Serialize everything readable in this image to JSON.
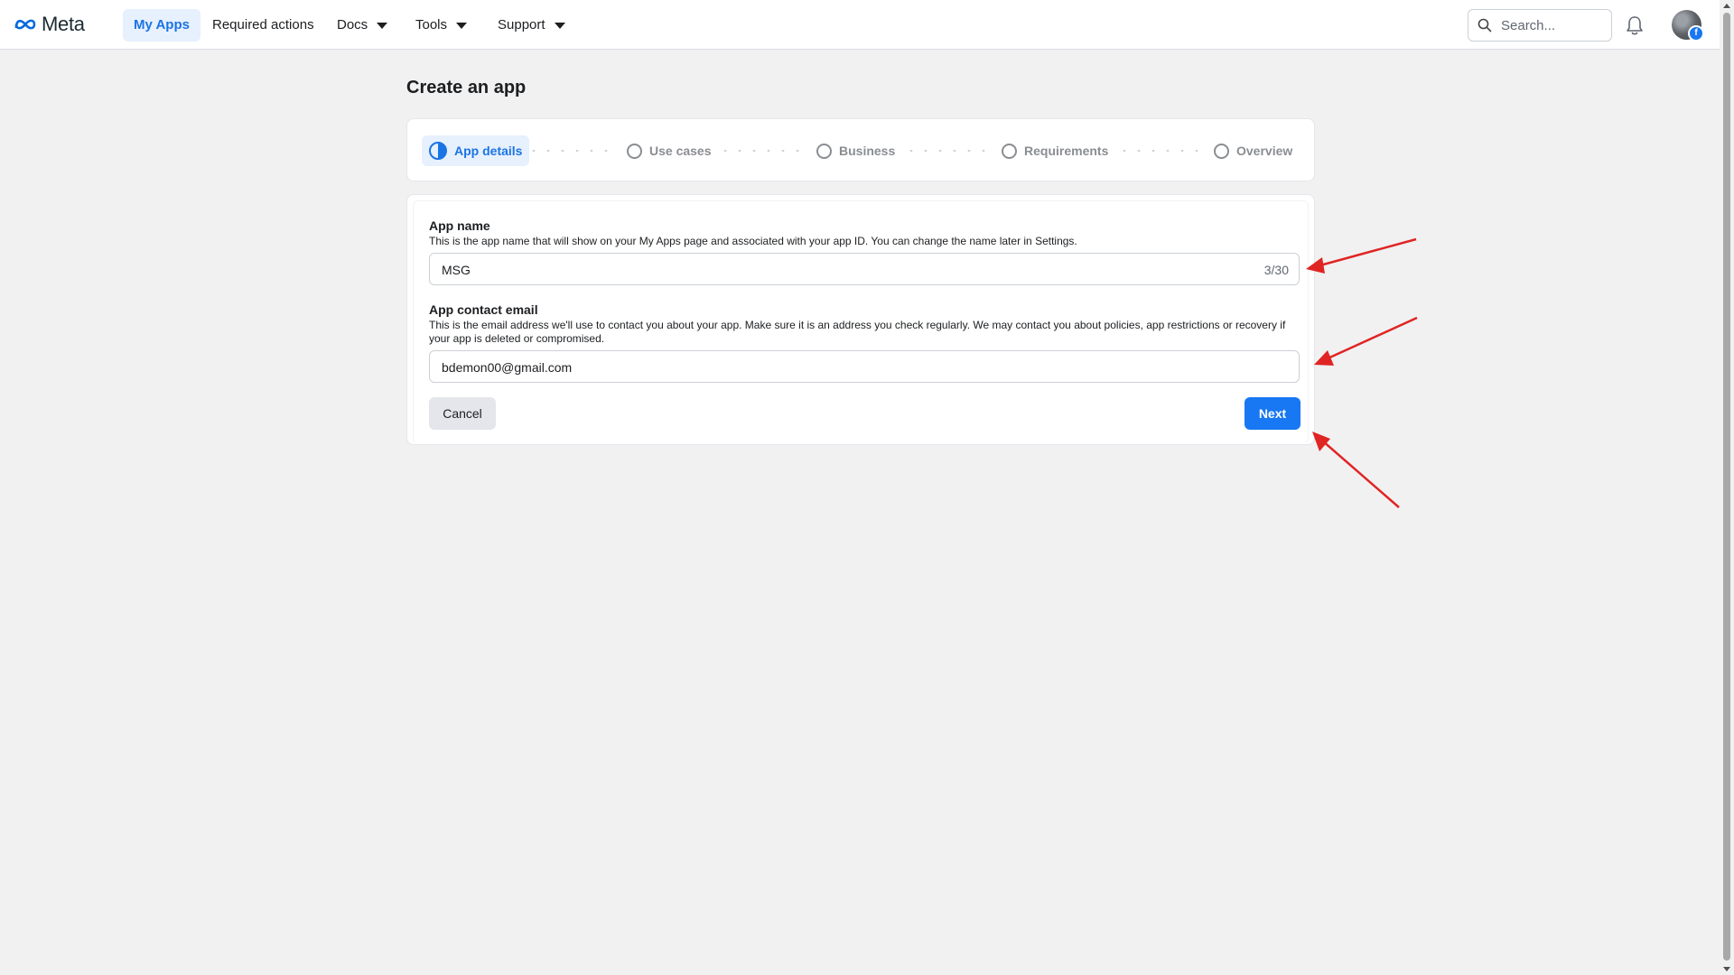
{
  "nav": {
    "logo_text": "Meta",
    "items": [
      {
        "label": "My Apps"
      },
      {
        "label": "Required actions"
      },
      {
        "label": "Docs"
      },
      {
        "label": "Tools"
      },
      {
        "label": "Support"
      }
    ],
    "search_placeholder": "Search...",
    "avatar_badge": "f"
  },
  "page": {
    "title": "Create an app"
  },
  "steps": [
    {
      "label": "App details",
      "state": "active"
    },
    {
      "label": "Use cases",
      "state": "pending"
    },
    {
      "label": "Business",
      "state": "pending"
    },
    {
      "label": "Requirements",
      "state": "pending"
    },
    {
      "label": "Overview",
      "state": "pending"
    }
  ],
  "form": {
    "app_name": {
      "label": "App name",
      "help": "This is the app name that will show on your My Apps page and associated with your app ID. You can change the name later in Settings.",
      "value": "MSG",
      "counter": "3/30"
    },
    "contact_email": {
      "label": "App contact email",
      "help": "This is the email address we'll use to contact you about your app. Make sure it is an address you check regularly. We may contact you about policies, app restrictions or recovery if your app is deleted or compromised.",
      "value": "bdemon00@gmail.com"
    },
    "cancel_label": "Cancel",
    "next_label": "Next"
  },
  "colors": {
    "accent": "#1877f2",
    "annotation_arrow": "#e02424"
  }
}
